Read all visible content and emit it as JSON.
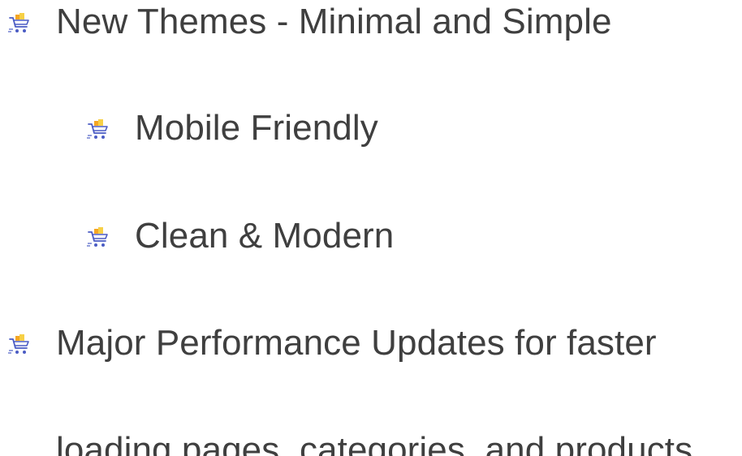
{
  "list": {
    "items": [
      {
        "icon": "shopping-cart-icon",
        "text": "New Themes - Minimal and Simple"
      },
      {
        "icon": "shopping-cart-icon",
        "text": "Mobile Friendly"
      },
      {
        "icon": "shopping-cart-icon",
        "text": "Clean & Modern"
      },
      {
        "icon": "shopping-cart-icon",
        "text": "Major Performance Updates for faster",
        "text_continued": "loading pages, categories, and products."
      }
    ]
  },
  "colors": {
    "text": "#3f3f3f",
    "icon_cart": "#4b5cc4",
    "icon_box_orange": "#f5a623",
    "icon_box_yellow": "#f7d046"
  }
}
